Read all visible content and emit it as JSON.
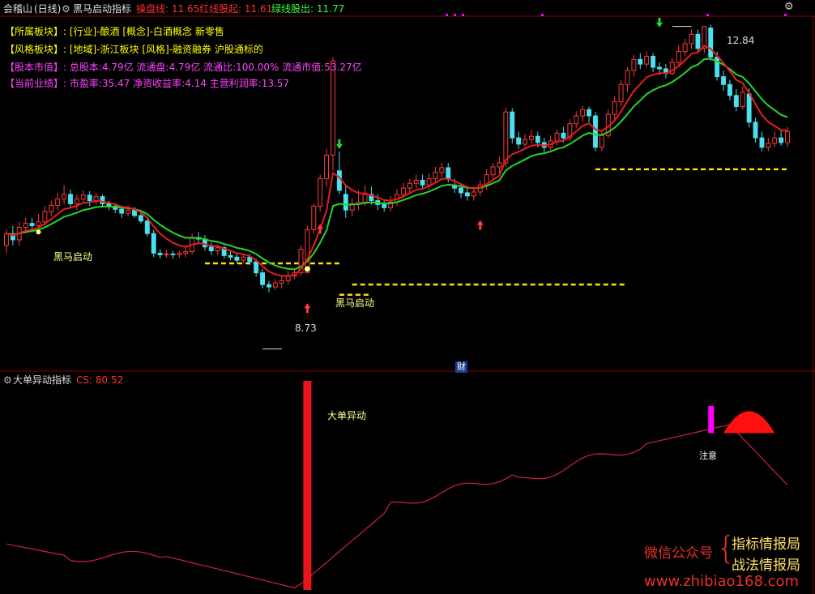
{
  "top_bar": {
    "stock_name": "会稽山",
    "period": "(日线)",
    "indicator_name": "黑马启动指标",
    "readouts": [
      {
        "label": "操盘线: ",
        "value": "11.65",
        "color": "#ff3030"
      },
      {
        "label": "红线股起: ",
        "value": "11.61",
        "color": "#ff3030"
      },
      {
        "label": "绿线股出: ",
        "value": "11.77",
        "color": "#33ff33"
      }
    ],
    "gear_icon": "gear-icon"
  },
  "info_lines": [
    {
      "label": "【所属板块】: ",
      "value": "[行业]-酿酒 [概念]-白酒概念 新零售",
      "label_color": "#ffff00",
      "value_color": "#ffff00"
    },
    {
      "label": "【风格板块】: ",
      "value": "[地域]-浙江板块 [风格]-融资融券 沪股通标的",
      "label_color": "#ffff00",
      "value_color": "#ffff00"
    },
    {
      "label": "【股本市值】: ",
      "value": "总股本:4.79亿 流通盘:4.79亿 流通比:100.00% 流通市值:53.27亿",
      "label_color": "#ff44ff",
      "value_color": "#ff44ff"
    },
    {
      "label": "【当前业绩】: ",
      "value": "市盈率:35.47 净资收益率:4.14 主营利润率:13.57",
      "label_color": "#ff44ff",
      "value_color": "#ff44ff"
    }
  ],
  "annotations": {
    "high_label": "12.84",
    "low_label": "8.73",
    "signal_label_1": "黑马启动",
    "signal_label_2": "黑马启动",
    "cai_badge": "财"
  },
  "sub_panel": {
    "indicator_name": "大单异动指标",
    "readout_label": "CS: ",
    "readout_value": "80.52",
    "spike_label": "大单异动",
    "notice_label": "注意"
  },
  "watermark": {
    "line1": "微信公众号",
    "brace": "{",
    "right1": "指标情报局",
    "right2": "战法情报局",
    "url": "www.zhibiao168.com"
  },
  "colors": {
    "up": "#ff3b3b",
    "down": "#4ae0f0",
    "ma_red": "#e61e1e",
    "ma_green": "#28d428",
    "support": "#ffe000",
    "cs_line": "#d02040",
    "magenta": "#ff00ff"
  },
  "chart_data": [
    {
      "type": "candlestick",
      "candles": [
        [
          10.05,
          10.2,
          10.25,
          9.95
        ],
        [
          10.2,
          10.12,
          10.3,
          10.05
        ],
        [
          10.12,
          10.28,
          10.35,
          10.05
        ],
        [
          10.28,
          10.33,
          10.4,
          10.2
        ],
        [
          10.33,
          10.3,
          10.4,
          10.22
        ],
        [
          10.3,
          10.35,
          10.45,
          10.25
        ],
        [
          10.35,
          10.48,
          10.55,
          10.3
        ],
        [
          10.48,
          10.56,
          10.62,
          10.42
        ],
        [
          10.56,
          10.64,
          10.72,
          10.5
        ],
        [
          10.64,
          10.7,
          10.82,
          10.58
        ],
        [
          10.7,
          10.58,
          10.76,
          10.52
        ],
        [
          10.58,
          10.64,
          10.7,
          10.5
        ],
        [
          10.64,
          10.69,
          10.75,
          10.58
        ],
        [
          10.69,
          10.62,
          10.74,
          10.55
        ],
        [
          10.62,
          10.67,
          10.72,
          10.57
        ],
        [
          10.67,
          10.58,
          10.7,
          10.54
        ],
        [
          10.58,
          10.55,
          10.62,
          10.5
        ],
        [
          10.55,
          10.51,
          10.58,
          10.46
        ],
        [
          10.51,
          10.46,
          10.54,
          10.4
        ],
        [
          10.46,
          10.5,
          10.56,
          10.42
        ],
        [
          10.5,
          10.43,
          10.54,
          10.4
        ],
        [
          10.43,
          10.36,
          10.47,
          10.33
        ],
        [
          10.36,
          10.2,
          10.4,
          10.16
        ],
        [
          10.2,
          9.95,
          10.25,
          9.9
        ],
        [
          9.95,
          9.93,
          10.0,
          9.88
        ],
        [
          9.93,
          9.94,
          9.99,
          9.89
        ],
        [
          9.94,
          9.93,
          9.98,
          9.88
        ],
        [
          9.93,
          9.95,
          9.99,
          9.89
        ],
        [
          9.95,
          9.97,
          10.05,
          9.9
        ],
        [
          9.97,
          10.15,
          10.2,
          9.93
        ],
        [
          10.15,
          10.13,
          10.22,
          10.08
        ],
        [
          10.13,
          10.03,
          10.18,
          9.98
        ],
        [
          10.03,
          9.98,
          10.08,
          9.93
        ],
        [
          9.98,
          10.02,
          10.06,
          9.93
        ],
        [
          10.02,
          9.92,
          10.05,
          9.88
        ],
        [
          9.92,
          9.9,
          9.97,
          9.86
        ],
        [
          9.9,
          9.86,
          9.95,
          9.82
        ],
        [
          9.86,
          9.9,
          9.94,
          9.82
        ],
        [
          9.9,
          9.84,
          9.94,
          9.8
        ],
        [
          9.84,
          9.7,
          9.88,
          9.65
        ],
        [
          9.7,
          9.55,
          9.75,
          9.5
        ],
        [
          9.55,
          9.52,
          9.6,
          9.45
        ],
        [
          9.52,
          9.57,
          9.62,
          9.48
        ],
        [
          9.57,
          9.6,
          9.66,
          9.5
        ],
        [
          9.6,
          9.66,
          9.72,
          9.55
        ],
        [
          9.66,
          9.7,
          9.76,
          9.62
        ],
        [
          9.7,
          10.0,
          10.05,
          9.66
        ],
        [
          9.7,
          10.25,
          10.3,
          9.7
        ],
        [
          10.25,
          10.55,
          10.58,
          10.2
        ],
        [
          10.55,
          10.9,
          10.95,
          10.48
        ],
        [
          10.9,
          11.2,
          11.28,
          10.8
        ],
        [
          11.2,
          12.4,
          12.45,
          11.0
        ],
        [
          11.0,
          10.75,
          11.25,
          10.7
        ],
        [
          10.7,
          10.5,
          10.8,
          10.4
        ],
        [
          10.5,
          10.58,
          10.65,
          10.42
        ],
        [
          10.58,
          10.6,
          10.75,
          10.5
        ],
        [
          10.6,
          10.7,
          10.82,
          10.55
        ],
        [
          10.7,
          10.62,
          10.8,
          10.57
        ],
        [
          10.62,
          10.57,
          10.7,
          10.5
        ],
        [
          10.57,
          10.53,
          10.63,
          10.48
        ],
        [
          10.53,
          10.6,
          10.68,
          10.48
        ],
        [
          10.6,
          10.7,
          10.77,
          10.55
        ],
        [
          10.7,
          10.78,
          10.85,
          10.65
        ],
        [
          10.78,
          10.84,
          10.9,
          10.72
        ],
        [
          10.84,
          10.88,
          10.95,
          10.78
        ],
        [
          10.88,
          10.82,
          10.95,
          10.77
        ],
        [
          10.82,
          10.9,
          10.97,
          10.76
        ],
        [
          10.9,
          10.98,
          11.05,
          10.84
        ],
        [
          10.98,
          11.04,
          11.1,
          10.92
        ],
        [
          11.04,
          10.9,
          11.1,
          10.85
        ],
        [
          10.82,
          10.78,
          10.9,
          10.72
        ],
        [
          10.78,
          10.72,
          10.84,
          10.65
        ],
        [
          10.72,
          10.68,
          10.79,
          10.62
        ],
        [
          10.68,
          10.73,
          10.8,
          10.62
        ],
        [
          10.73,
          10.82,
          10.88,
          10.68
        ],
        [
          10.82,
          10.95,
          11.02,
          10.76
        ],
        [
          10.95,
          11.05,
          11.1,
          10.9
        ],
        [
          11.05,
          11.1,
          11.18,
          10.97
        ],
        [
          11.1,
          11.75,
          11.8,
          11.05
        ],
        [
          11.75,
          11.42,
          11.8,
          11.35
        ],
        [
          11.42,
          11.34,
          11.5,
          11.28
        ],
        [
          11.34,
          11.4,
          11.47,
          11.3
        ],
        [
          11.4,
          11.44,
          11.52,
          11.35
        ],
        [
          11.44,
          11.36,
          11.5,
          11.3
        ],
        [
          11.36,
          11.3,
          11.42,
          11.24
        ],
        [
          11.3,
          11.38,
          11.45,
          11.26
        ],
        [
          11.38,
          11.48,
          11.53,
          11.32
        ],
        [
          11.48,
          11.42,
          11.56,
          11.36
        ],
        [
          11.42,
          11.6,
          11.66,
          11.38
        ],
        [
          11.6,
          11.7,
          11.76,
          11.55
        ],
        [
          11.7,
          11.78,
          11.83,
          11.63
        ],
        [
          11.78,
          11.7,
          11.82,
          11.62
        ],
        [
          11.7,
          11.3,
          11.75,
          11.25
        ],
        [
          11.3,
          11.45,
          11.52,
          11.25
        ],
        [
          11.45,
          11.72,
          11.78,
          11.42
        ],
        [
          11.72,
          11.88,
          11.95,
          11.66
        ],
        [
          11.88,
          12.1,
          12.16,
          11.82
        ],
        [
          12.1,
          12.28,
          12.32,
          12.0
        ],
        [
          12.28,
          12.42,
          12.48,
          12.2
        ],
        [
          12.42,
          12.36,
          12.5,
          12.3
        ],
        [
          12.36,
          12.46,
          12.52,
          12.32
        ],
        [
          12.46,
          12.32,
          12.5,
          12.26
        ],
        [
          12.32,
          12.3,
          12.38,
          12.22
        ],
        [
          12.3,
          12.24,
          12.36,
          12.18
        ],
        [
          12.24,
          12.38,
          12.44,
          12.22
        ],
        [
          12.38,
          12.52,
          12.6,
          12.32
        ],
        [
          12.52,
          12.62,
          12.68,
          12.46
        ],
        [
          12.62,
          12.74,
          12.8,
          12.55
        ],
        [
          12.74,
          12.56,
          12.8,
          12.5
        ],
        [
          12.56,
          12.84,
          12.84,
          12.5
        ],
        [
          12.82,
          12.45,
          12.86,
          12.4
        ],
        [
          12.45,
          12.2,
          12.52,
          12.15
        ],
        [
          12.2,
          12.1,
          12.28,
          12.02
        ],
        [
          12.1,
          11.96,
          12.16,
          11.9
        ],
        [
          11.96,
          11.82,
          12.04,
          11.76
        ],
        [
          11.82,
          12.0,
          12.08,
          11.78
        ],
        [
          11.98,
          11.62,
          12.05,
          11.55
        ],
        [
          11.62,
          11.42,
          11.68,
          11.36
        ],
        [
          11.42,
          11.3,
          11.5,
          11.25
        ],
        [
          11.3,
          11.35,
          11.42,
          11.25
        ],
        [
          11.35,
          11.42,
          11.5,
          11.3
        ],
        [
          11.42,
          11.36,
          11.52,
          11.32
        ],
        [
          11.36,
          11.5,
          11.56,
          11.3
        ]
      ],
      "ylim": [
        8.55,
        12.95
      ],
      "high_point": 12.84,
      "low_point": 8.73,
      "support_levels": [
        9.82,
        9.55,
        11.02
      ]
    },
    {
      "type": "line",
      "series": [
        {
          "name": "CS",
          "last": 80.52
        }
      ],
      "spike_value": 100
    }
  ]
}
